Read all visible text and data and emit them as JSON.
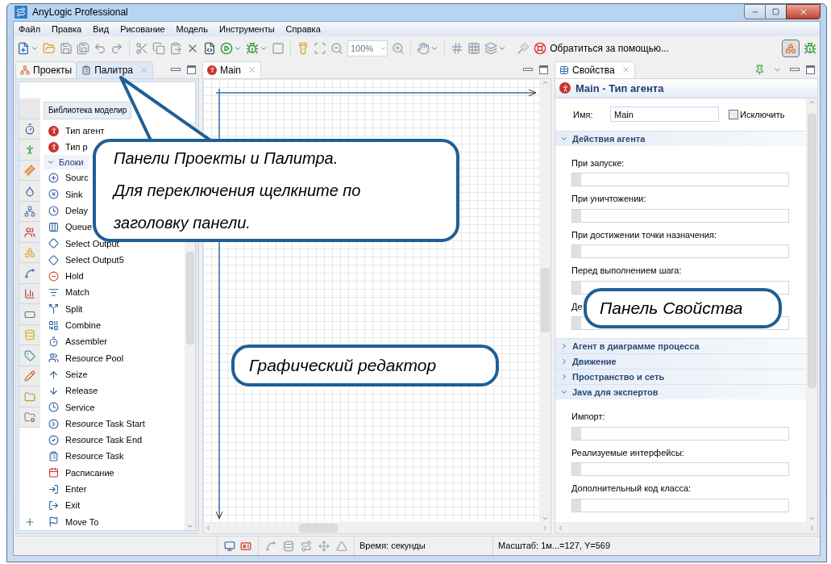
{
  "window": {
    "title": "AnyLogic Professional"
  },
  "menu": [
    "Файл",
    "Правка",
    "Вид",
    "Рисование",
    "Модель",
    "Инструменты",
    "Справка"
  ],
  "toolbar": {
    "zoom": "100%",
    "help": "Обратиться за помощью..."
  },
  "left_panel": {
    "tabs": [
      {
        "label": "Проекты",
        "selected": false
      },
      {
        "label": "Палитра",
        "selected": true
      }
    ],
    "library": "Библиотека моделир",
    "agent_items": [
      "Тип агент",
      "Тип р"
    ],
    "section": {
      "label": "Блоки",
      "expanded": true,
      "items": [
        "Sourc",
        "Sink",
        "Delay",
        "Queue",
        "Select Output",
        "Select Output5",
        "Hold",
        "Match",
        "Split",
        "Combine",
        "Assembler",
        "Resource Pool",
        "Seize",
        "Release",
        "Service",
        "Resource Task Start",
        "Resource Task End",
        "Resource Task",
        "Расписание",
        "Enter",
        "Exit",
        "Move To"
      ]
    }
  },
  "editor": {
    "tabs": [
      {
        "label": "Main",
        "selected": true
      }
    ]
  },
  "properties": {
    "tab": "Свойства",
    "title": "Main - Тип агента",
    "name_label": "Имя:",
    "name_value": "Main",
    "exclude": {
      "label": "Исключить",
      "checked": false
    },
    "sections": [
      {
        "label": "Действия агента",
        "expanded": true,
        "fields": [
          "При запуске:",
          "При уничтожении:",
          "При достижении точки назначения:",
          "Перед выполнением шага:",
          "Де"
        ]
      },
      {
        "label": "Агент в диаграмме процесса",
        "expanded": false
      },
      {
        "label": "Движение",
        "expanded": false
      },
      {
        "label": "Пространство и сеть",
        "expanded": false
      },
      {
        "label": "Java для экспертов",
        "expanded": true,
        "fields": [
          "Импорт:",
          "Реализуемые интерфейсы:",
          "Дополнительный код класса:"
        ]
      }
    ]
  },
  "status_bar": {
    "time": "Время: секунды",
    "scale": "Масштаб: 1м...=127, Y=569"
  },
  "callouts": [
    {
      "kind": "pointer",
      "lines": [
        "Панели Проекты и Палитра.",
        "Для переключения щелкните по",
        "заголовку панели."
      ]
    },
    {
      "kind": "plain",
      "lines": [
        "Панель Свойства"
      ]
    },
    {
      "kind": "plain",
      "lines": [
        "Графический редактор"
      ]
    }
  ]
}
